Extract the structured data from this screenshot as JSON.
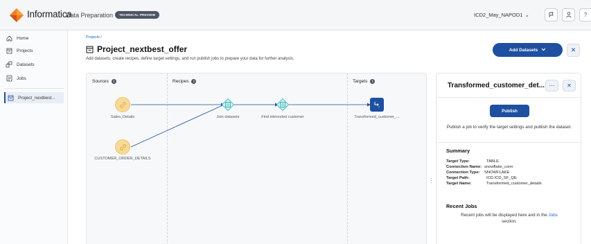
{
  "app": {
    "brand": "Informatica",
    "product": "Data Preparation",
    "badge": "TECHNICAL PREVIEW",
    "org": "ICD2_May_NAPOD1",
    "colors": {
      "primary": "#1e4fa0",
      "source_node": "#f7d999",
      "recipe_node": "#4bc4c8"
    }
  },
  "sidebar": {
    "items": [
      {
        "label": "Home",
        "icon": "home-icon"
      },
      {
        "label": "Projects",
        "icon": "projects-icon"
      },
      {
        "label": "Datasets",
        "icon": "datasets-icon"
      },
      {
        "label": "Jobs",
        "icon": "jobs-icon"
      },
      {
        "label": "Project_nextbest...",
        "icon": "project-icon",
        "active": true
      }
    ]
  },
  "header": {
    "breadcrumb_link": "Projects",
    "breadcrumb_sep": "/",
    "title": "Project_nextbest_offer",
    "subtitle": "Add datasets, create recipes, define target settings, and run publish jobs to prepare your data for further analysis.",
    "add_datasets_label": "Add Datasets",
    "close_label": "✕"
  },
  "canvas": {
    "columns": {
      "sources": "Sources",
      "recipes": "Recipes",
      "targets": "Targets"
    },
    "sources": [
      "Sales_Details",
      "CUSTOMER_ORDER_DETAILS"
    ],
    "recipes": [
      "Join datasets",
      "Find interested customer"
    ],
    "targets": [
      "Transformed_customer_..."
    ]
  },
  "panel": {
    "title": "Transformed_customer_det...",
    "more_label": "⋯",
    "close_label": "✕",
    "publish_label": "Publish",
    "publish_desc": "Publish a job to verify the target settings and publish the dataset.",
    "summary_title": "Summary",
    "summary": [
      {
        "key": "Target Type:",
        "value": "TABLE"
      },
      {
        "key": "Connection Name:",
        "value": "snowflake_conn"
      },
      {
        "key": "Connection Type:",
        "value": "SNOWFLAKE"
      },
      {
        "key": "Target Path:",
        "value": "ICD.ICD_SF_QE"
      },
      {
        "key": "Target Name:",
        "value": "Transformed_customer_details"
      }
    ],
    "recent_jobs_title": "Recent Jobs",
    "recent_jobs_desc_pre": "Recent jobs will be displayed here and in the",
    "recent_jobs_link": "Jobs",
    "recent_jobs_desc_post": "section."
  }
}
